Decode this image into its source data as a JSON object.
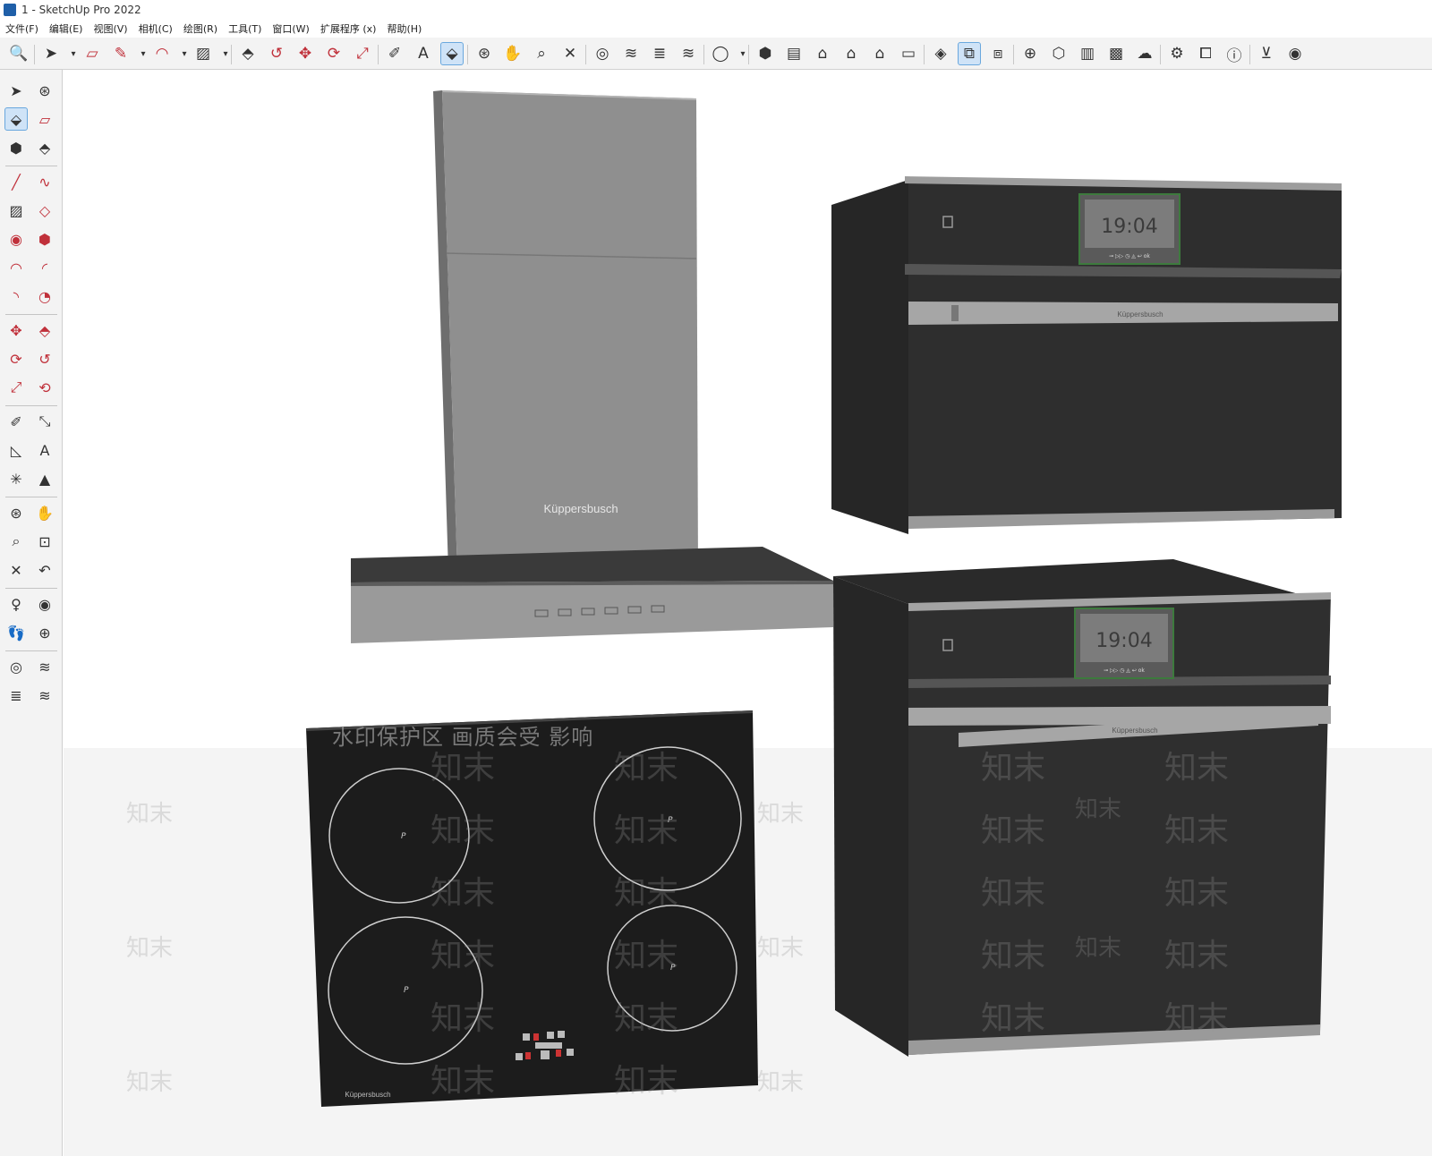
{
  "window": {
    "title": "1 - SketchUp Pro 2022"
  },
  "menu": [
    "文件(F)",
    "编辑(E)",
    "视图(V)",
    "相机(C)",
    "绘图(R)",
    "工具(T)",
    "窗口(W)",
    "扩展程序 (x)",
    "帮助(H)"
  ],
  "toolbar_icons": [
    "zoom-icon",
    "select-icon",
    "dropdown-icon",
    "eraser-icon",
    "pencil-icon",
    "dropdown-icon",
    "arc-icon",
    "dropdown-icon",
    "rectangle-icon",
    "dropdown-icon",
    "push-pull-icon",
    "follow-me-icon",
    "move-icon",
    "rotate-icon",
    "scale-icon",
    "tape-measure-icon",
    "text-icon",
    "paint-bucket-icon",
    "orbit-icon",
    "pan-icon",
    "zoom-tool-icon",
    "zoom-extents-icon",
    "warehouse-icon",
    "extension-icon",
    "layers-icon",
    "sandbox-icon",
    "account-icon",
    "dropdown-icon",
    "iso-view-icon",
    "top-view-icon",
    "front-view-icon",
    "right-view-icon",
    "back-view-icon",
    "left-view-icon",
    "solid-tools-icon",
    "outer-shell-icon",
    "section-icon",
    "add-location-icon",
    "styles-icon",
    "shadow-icon",
    "match-photo-icon",
    "cloud-icon",
    "settings-icon",
    "dynamic-component-icon",
    "info-icon",
    "cart-icon",
    "user-icon"
  ],
  "left_tools": [
    "select-icon",
    "orbit-icon",
    "paint-bucket-icon",
    "eraser-icon",
    "component-icon",
    "tag-icon",
    "line-icon",
    "freehand-icon",
    "rectangle-icon",
    "rotated-rectangle-icon",
    "circle-icon",
    "polygon-icon",
    "arc-icon",
    "two-point-arc-icon",
    "three-point-arc-icon",
    "pie-icon",
    "move-icon",
    "push-pull-icon",
    "rotate-icon",
    "follow-me-icon",
    "scale-icon",
    "offset-icon",
    "tape-measure-icon",
    "dimension-icon",
    "protractor-icon",
    "text-icon",
    "axes-icon",
    "3d-text-icon",
    "orbit-tool-icon",
    "pan-icon",
    "zoom-icon",
    "zoom-window-icon",
    "zoom-extents-icon",
    "previous-view-icon",
    "position-camera-icon",
    "look-around-icon",
    "walk-icon",
    "section-plane-icon",
    "warehouse-icon",
    "extension-warehouse-icon",
    "layout-icon",
    "share-icon"
  ],
  "model": {
    "hood_brand": "Küppersbusch",
    "oven_top_clock": "19:04",
    "oven_top_brand": "Küppersbusch",
    "oven_top_controls": "⊸ ▷▷ ◷ ◬ ↩ ok",
    "oven_bottom_clock": "19:04",
    "oven_bottom_brand": "Küppersbusch",
    "oven_bottom_controls": "⊸ ▷▷ ◷ ◬ ↩ ok",
    "hob_brand": "Küppersbusch",
    "zone_label": "P"
  },
  "watermark": {
    "banner": "水印保护区   画质会受   影响",
    "text": "知末"
  },
  "colors": {
    "hood_gray": "#8f8f8f",
    "appliance_black": "#2b2b2b",
    "display_bg": "#7c7c7c",
    "trim_gray": "#a9a9a9",
    "toolbar_bg": "#f3f3f3"
  }
}
